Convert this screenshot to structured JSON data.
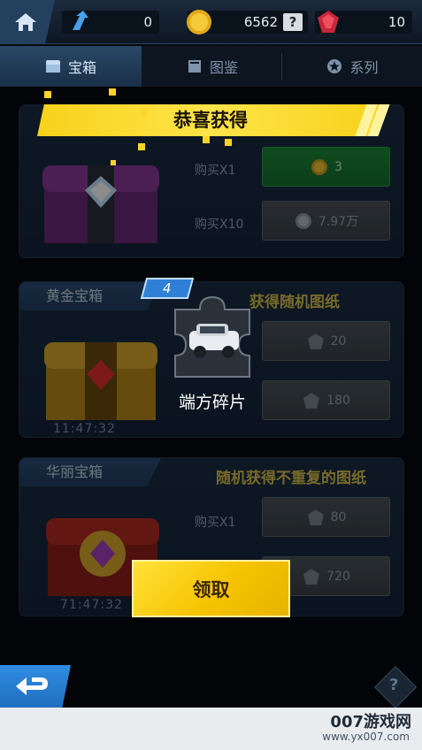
{
  "topbar": {
    "stats": [
      {
        "icon": "arrow-up-icon",
        "value": "0"
      },
      {
        "icon": "gold-coin-icon",
        "value": "6562"
      },
      {
        "icon": "red-gem-icon",
        "value": "10"
      }
    ],
    "help_glyph": "?"
  },
  "tabs": [
    {
      "label": "宝箱",
      "icon": "chest-icon",
      "active": true
    },
    {
      "label": "图鉴",
      "icon": "book-icon",
      "active": false
    },
    {
      "label": "系列",
      "icon": "star-badge-icon",
      "active": false
    }
  ],
  "panels": [
    {
      "title": "",
      "subtitle": "",
      "options": [
        {
          "label": "购买X1",
          "price": "3",
          "currency_icon": "gold-coin-icon",
          "style": "green"
        },
        {
          "label": "购买X10",
          "price": "7.97万",
          "currency_icon": "silver-coin-icon",
          "style": "gray"
        }
      ],
      "timer": ""
    },
    {
      "title": "黄金宝箱",
      "subtitle": "获得随机图纸",
      "options": [
        {
          "label": "",
          "price": "20",
          "currency_icon": "ore-icon",
          "style": "gray"
        },
        {
          "label": "",
          "price": "180",
          "currency_icon": "ore-icon",
          "style": "gray"
        }
      ],
      "timer": "11:47:32"
    },
    {
      "title": "华丽宝箱",
      "subtitle": "随机获得不重复的图纸",
      "options": [
        {
          "label": "购买X1",
          "price": "80",
          "currency_icon": "ore-icon",
          "style": "gray"
        },
        {
          "label": "",
          "price": "720",
          "currency_icon": "ore-icon",
          "style": "gray"
        }
      ],
      "timer": "71:47:32"
    }
  ],
  "reward": {
    "banner": "恭喜获得",
    "count": "4",
    "name": "端方碎片",
    "claim_label": "领取"
  },
  "bottom": {
    "help_glyph": "?"
  },
  "watermark": {
    "text": "007游戏网",
    "url": "www.yx007.com"
  },
  "colors": {
    "accent_yellow": "#f7d21a",
    "buy_green": "#1d8a3a",
    "back_blue": "#2f8de0"
  }
}
